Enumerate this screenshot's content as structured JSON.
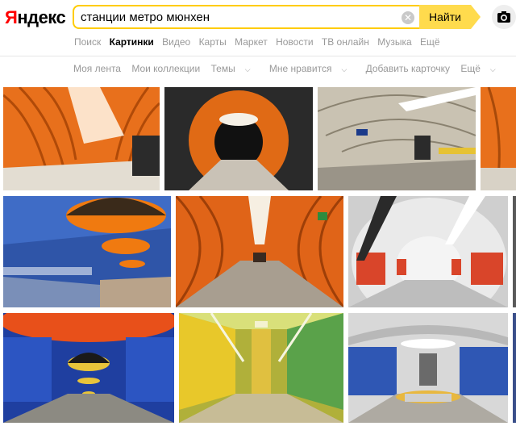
{
  "logo": {
    "first_letter": "Я",
    "rest": "ндекс"
  },
  "search": {
    "query": "станции метро мюнхен",
    "button_label": "Найти",
    "clear_glyph": "✕"
  },
  "tabs": [
    {
      "label": "Поиск"
    },
    {
      "label": "Картинки"
    },
    {
      "label": "Видео"
    },
    {
      "label": "Карты"
    },
    {
      "label": "Маркет"
    },
    {
      "label": "Новости"
    },
    {
      "label": "ТВ онлайн"
    },
    {
      "label": "Музыка"
    },
    {
      "label": "Ещё"
    }
  ],
  "subnav": [
    {
      "label": "Моя лента"
    },
    {
      "label": "Мои коллекции"
    },
    {
      "label": "Темы"
    },
    {
      "label": "Мне нравится"
    },
    {
      "label": "Добавить карточку"
    },
    {
      "label": "Ещё"
    }
  ],
  "icons": {
    "camera": "camera-icon",
    "clear": "clear-icon"
  },
  "colors": {
    "accent": "#ffdb4d",
    "logo_red": "#ff0000",
    "search_border": "#ffcc00",
    "muted": "#999999"
  }
}
